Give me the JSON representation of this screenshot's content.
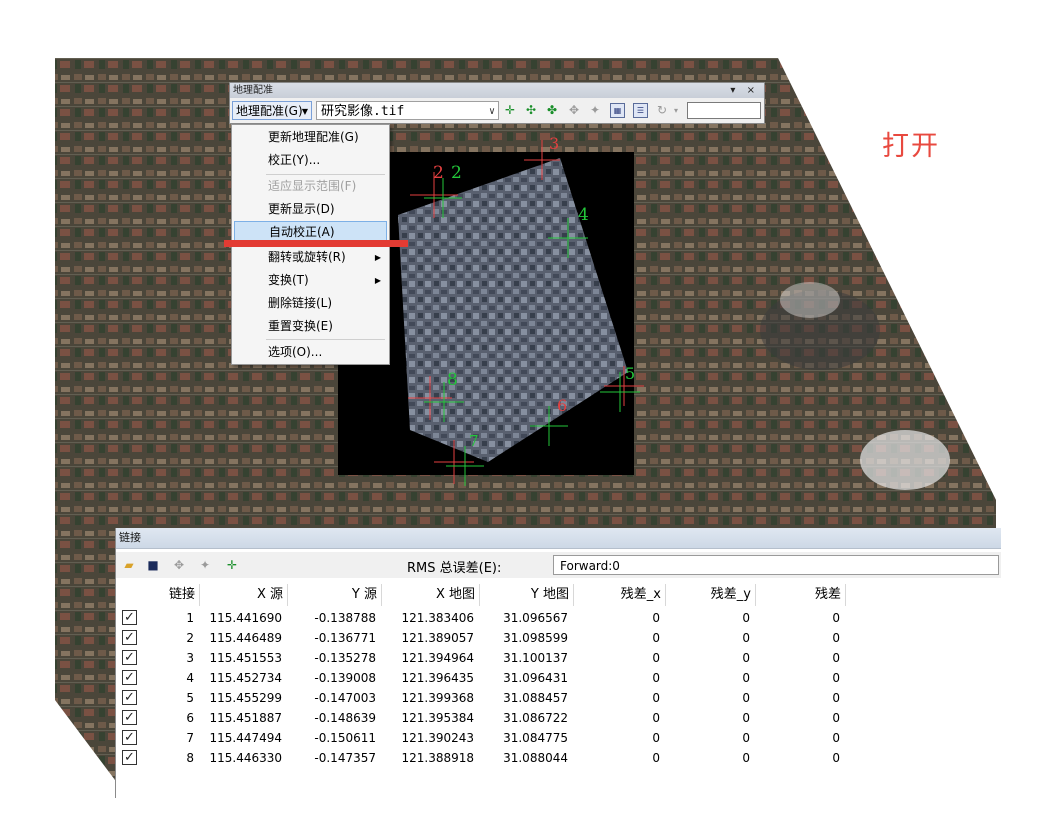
{
  "annotation": {
    "label": "打开",
    "color": "#e8493f"
  },
  "georef_toolbar": {
    "title": "地理配准",
    "window_controls": "▾ ×",
    "menu_label": "地理配准(G)",
    "layer_value": "研究影像.tif",
    "icons": [
      "add-control-points-icon",
      "auto-adjust-icon",
      "select-link-icon",
      "zoom-to-selected-link-icon",
      "delete-link-icon",
      "viewer-icon",
      "link-table-icon",
      "rotate-icon"
    ],
    "rotate_field_value": ""
  },
  "dropdown": {
    "items": [
      {
        "label": "更新地理配准(G)",
        "enabled": true
      },
      {
        "label": "校正(Y)...",
        "enabled": true
      },
      {
        "label": "适应显示范围(F)",
        "enabled": false
      },
      {
        "label": "更新显示(D)",
        "enabled": true
      },
      {
        "label": "自动校正(A)",
        "enabled": true,
        "highlighted": true
      },
      {
        "label": "翻转或旋转(R)",
        "enabled": true,
        "submenu": true
      },
      {
        "label": "变换(T)",
        "enabled": true,
        "submenu": true
      },
      {
        "label": "删除链接(L)",
        "enabled": true
      },
      {
        "label": "重置变换(E)",
        "enabled": true
      },
      {
        "label": "选项(O)...",
        "enabled": true
      }
    ],
    "highlight_marker_color": "#e33b33"
  },
  "map_points": [
    "1",
    "2",
    "2",
    "3",
    "4",
    "5",
    "6",
    "7",
    "8"
  ],
  "links_panel": {
    "title": "链接",
    "rms_label": "RMS 总误差(E):",
    "rms_value": "Forward:0",
    "columns": [
      "链接",
      "X 源",
      "Y 源",
      "X 地图",
      "Y 地图",
      "残差_x",
      "残差_y",
      "残差"
    ],
    "rows": [
      [
        "1",
        "115.441690",
        "-0.138788",
        "121.383406",
        "31.096567",
        "0",
        "0",
        "0"
      ],
      [
        "2",
        "115.446489",
        "-0.136771",
        "121.389057",
        "31.098599",
        "0",
        "0",
        "0"
      ],
      [
        "3",
        "115.451553",
        "-0.135278",
        "121.394964",
        "31.100137",
        "0",
        "0",
        "0"
      ],
      [
        "4",
        "115.452734",
        "-0.139008",
        "121.396435",
        "31.096431",
        "0",
        "0",
        "0"
      ],
      [
        "5",
        "115.455299",
        "-0.147003",
        "121.399368",
        "31.088457",
        "0",
        "0",
        "0"
      ],
      [
        "6",
        "115.451887",
        "-0.148639",
        "121.395384",
        "31.086722",
        "0",
        "0",
        "0"
      ],
      [
        "7",
        "115.447494",
        "-0.150611",
        "121.390243",
        "31.084775",
        "0",
        "0",
        "0"
      ],
      [
        "8",
        "115.446330",
        "-0.147357",
        "121.388918",
        "31.088044",
        "0",
        "0",
        "0"
      ]
    ]
  }
}
